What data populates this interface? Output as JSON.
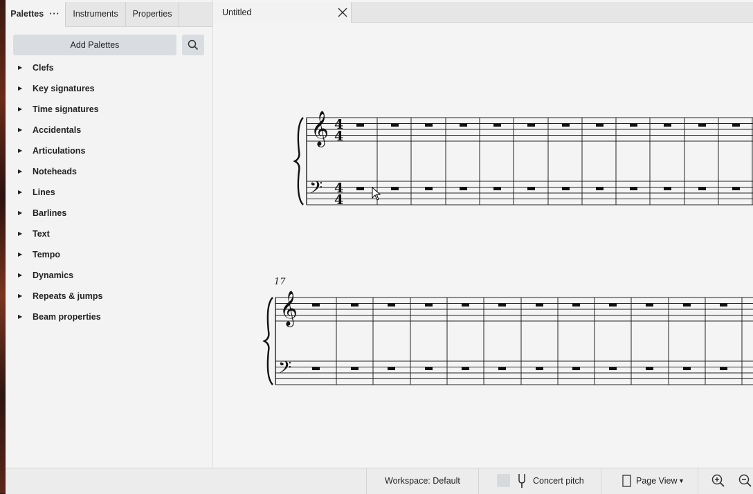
{
  "left_panel": {
    "tabs": [
      {
        "label": "Palettes",
        "active": true,
        "menu": "···"
      },
      {
        "label": "Instruments",
        "active": false
      },
      {
        "label": "Properties",
        "active": false
      }
    ],
    "add_palettes_label": "Add Palettes",
    "search_icon": "search-icon",
    "palettes": [
      "Clefs",
      "Key signatures",
      "Time signatures",
      "Accidentals",
      "Articulations",
      "Noteheads",
      "Lines",
      "Barlines",
      "Text",
      "Tempo",
      "Dynamics",
      "Repeats & jumps",
      "Beam properties"
    ]
  },
  "document": {
    "tab_title": "Untitled",
    "close_icon": "close-icon",
    "score": {
      "system2_measure_number": "17",
      "time_signature": [
        "4",
        "4"
      ]
    }
  },
  "status_bar": {
    "workspace": "Workspace: Default",
    "concert_pitch": "Concert pitch",
    "concert_pitch_checked": false,
    "view_mode": "Page View",
    "zoom_in_icon": "zoom-in-icon",
    "zoom_out_icon": "zoom-out-icon"
  },
  "colors": {
    "panel_bg": "#f3f3f3",
    "button_bg": "#d9dde1",
    "score_bg": "#f4f4f4"
  }
}
